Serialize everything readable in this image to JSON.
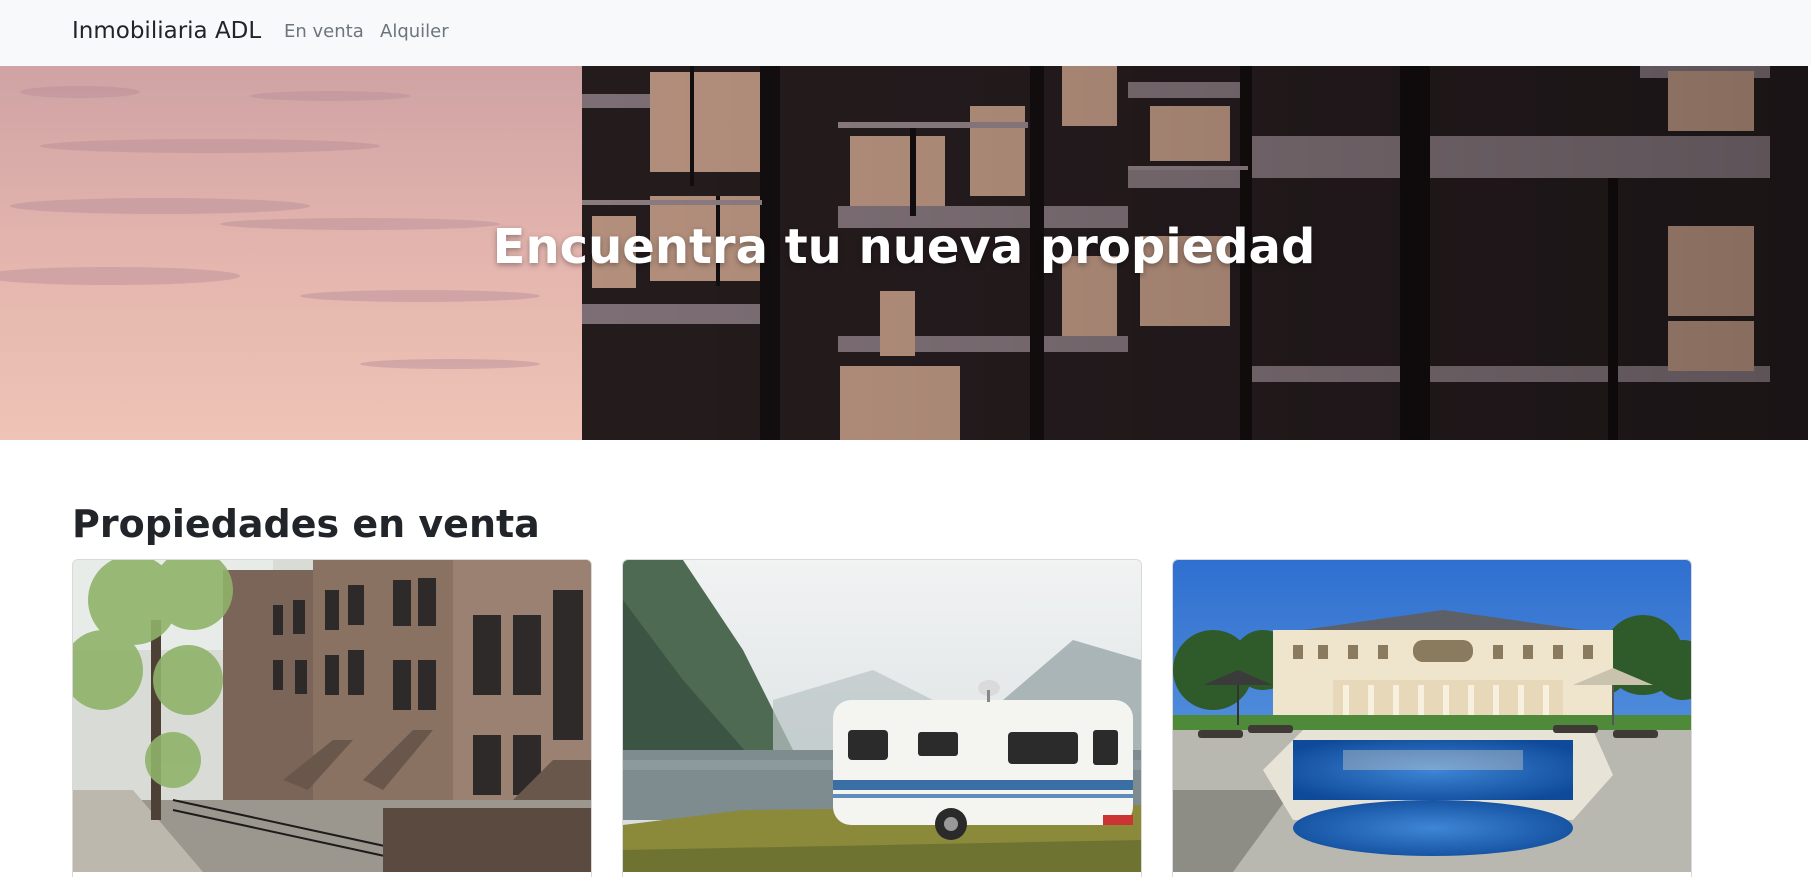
{
  "navbar": {
    "brand": "Inmobiliaria ADL",
    "links": [
      {
        "label": "En venta"
      },
      {
        "label": "Alquiler"
      }
    ]
  },
  "hero": {
    "title": "Encuentra tu nueva propiedad"
  },
  "section": {
    "title": "Propiedades en venta",
    "cards": [
      {
        "image": "brownstone-townhouses-photo"
      },
      {
        "image": "caravan-by-fjord-photo"
      },
      {
        "image": "mansion-with-pool-photo"
      }
    ]
  },
  "colors": {
    "navbar_bg": "#f8f9fa",
    "brand_text": "#212529",
    "nav_link": "#6c757d",
    "hero_text": "#ffffff"
  }
}
